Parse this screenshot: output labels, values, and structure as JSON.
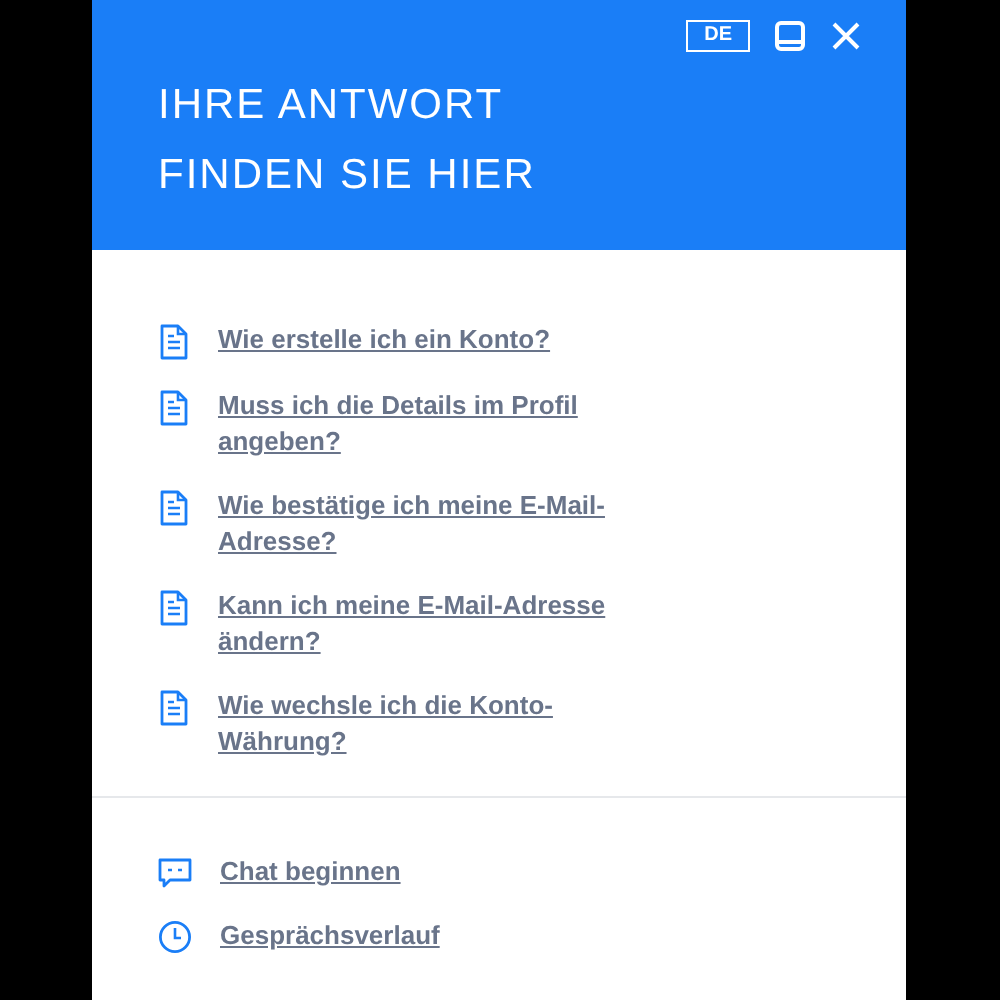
{
  "header": {
    "language": "DE",
    "title": "IHRE ANTWORT FINDEN SIE HIER"
  },
  "faq": [
    {
      "text": "Wie erstelle ich ein Konto?"
    },
    {
      "text": "Muss ich die Details im Profil angeben?"
    },
    {
      "text": "Wie bestätige ich meine E-Mail-Adresse?"
    },
    {
      "text": "Kann ich meine E-Mail-Adresse ändern?"
    },
    {
      "text": "Wie wechsle ich die Konto-Währung?"
    }
  ],
  "actions": [
    {
      "kind": "chat",
      "text": "Chat beginnen"
    },
    {
      "kind": "history",
      "text": "Gesprächsverlauf"
    }
  ]
}
